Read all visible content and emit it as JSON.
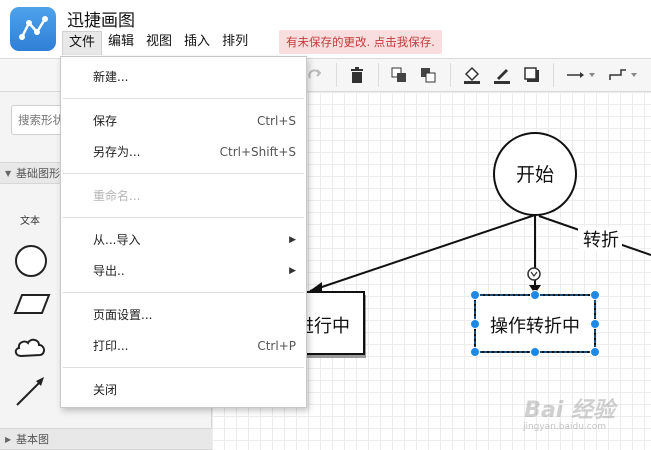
{
  "app": {
    "title": "迅捷画图",
    "brand_color": "#3a8ee6"
  },
  "menubar": {
    "items": [
      {
        "label": "文件",
        "active": true
      },
      {
        "label": "编辑"
      },
      {
        "label": "视图"
      },
      {
        "label": "插入"
      },
      {
        "label": "排列"
      }
    ],
    "unsaved_notice": "有未保存的更改. 点击我保存."
  },
  "toolbar": {
    "icons": [
      "redo-icon",
      "delete-icon",
      "to-front-icon",
      "to-back-icon",
      "fill-color-icon",
      "line-color-icon",
      "shadow-icon",
      "connection-icon",
      "waypoints-icon"
    ]
  },
  "sidebar": {
    "search_placeholder": "搜索形状",
    "section_basic_shapes": "基础图形",
    "text_shape_label": "文本",
    "section_basic": "基本图"
  },
  "file_menu": {
    "items": [
      {
        "label": "新建...",
        "shortcut": ""
      },
      {
        "label": "保存",
        "shortcut": "Ctrl+S"
      },
      {
        "label": "另存为...",
        "shortcut": "Ctrl+Shift+S"
      },
      {
        "label": "重命名...",
        "shortcut": "",
        "disabled": true
      },
      {
        "label": "从...导入",
        "submenu": true
      },
      {
        "label": "导出..",
        "submenu": true
      },
      {
        "label": "页面设置...",
        "shortcut": ""
      },
      {
        "label": "打印...",
        "shortcut": "Ctrl+P"
      },
      {
        "label": "关闭",
        "shortcut": ""
      }
    ]
  },
  "diagram": {
    "start_node": "开始",
    "turn_label": "转折",
    "left_node": "进行中",
    "selected_node": "操作转折中",
    "selection_color": "#1e88e5"
  },
  "watermark": {
    "text": "Bai 经验",
    "sub": "jingyan.baidu.com"
  }
}
